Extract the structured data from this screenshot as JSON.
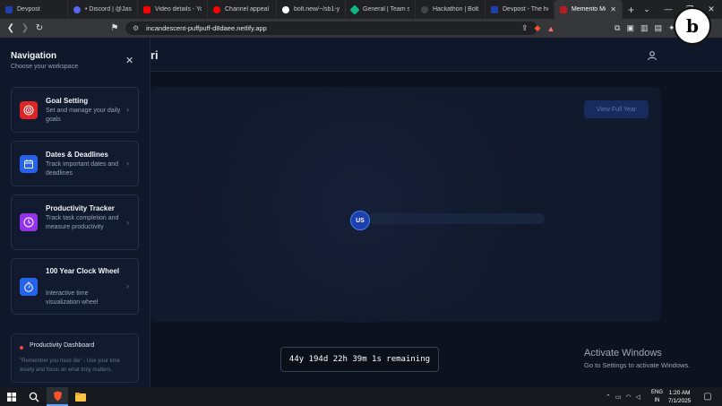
{
  "browser": {
    "tabs": [
      {
        "label": "Devpost",
        "color": "#1e40af"
      },
      {
        "label": "• Discord | @Jason",
        "color": "#5865f2"
      },
      {
        "label": "Video details - Yo",
        "color": "#ff0000"
      },
      {
        "label": "Channel appeal - Y",
        "color": "#ff0000"
      },
      {
        "label": "bolt.new/~/sb1-y",
        "color": "#ffffff"
      },
      {
        "label": "General | Team se",
        "color": "#10b981"
      },
      {
        "label": "Hackathon | Bolt.n",
        "color": "#111111"
      },
      {
        "label": "Devpost - The hom",
        "color": "#1e40af"
      },
      {
        "label": "Memento Mo",
        "color": "#b91c1c"
      }
    ],
    "url": "incandescent-puffpuff-d8daee.netlify.app"
  },
  "app": {
    "title_partial": "ri",
    "user_initials": "US",
    "timer": "44y 194d 22h 39m 1s remaining",
    "faded_button": "View Full Year",
    "badge_letter": "b"
  },
  "navigation": {
    "title": "Navigation",
    "subtitle": "Choose your workspace",
    "items": [
      {
        "title": "Goal Setting",
        "desc": "Set and manage your daily goals",
        "icon": "target-icon",
        "color": "#dc2626"
      },
      {
        "title": "Dates & Deadlines",
        "desc": "Track important dates and deadlines",
        "icon": "calendar-icon",
        "color": "#2563eb"
      },
      {
        "title": "Productivity Tracker",
        "desc": "Track task completion and measure productivity",
        "icon": "clock-icon",
        "color": "#9333ea"
      },
      {
        "title": "100 Year Clock Wheel",
        "desc": "Interactive time visualization wheel",
        "icon": "timer-icon",
        "color": "#2563eb"
      }
    ],
    "dashboard": {
      "title": "Productivity Dashboard",
      "quote": "\"Remember you must die\" - Use your time wisely and focus on what truly matters."
    }
  },
  "windows": {
    "activate_title": "Activate Windows",
    "activate_sub": "Go to Settings to activate Windows.",
    "lang_top": "ENG",
    "lang_bottom": "IN",
    "time": "1:20 AM",
    "date": "7/1/2025"
  }
}
